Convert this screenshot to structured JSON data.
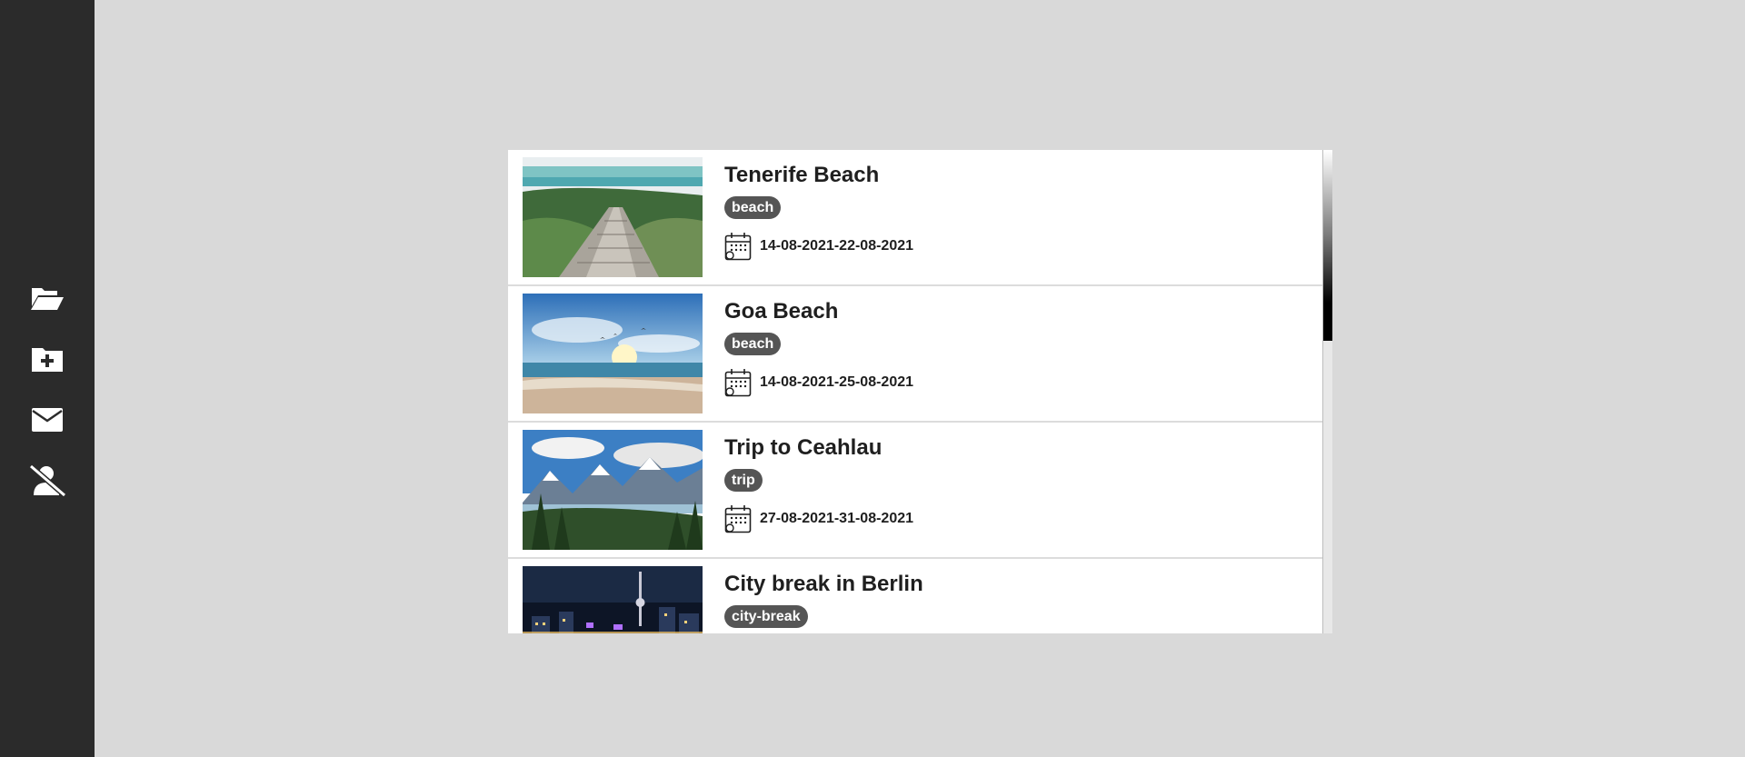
{
  "sidebar": {
    "items": [
      {
        "icon": "folder-open-icon"
      },
      {
        "icon": "folder-plus-icon"
      },
      {
        "icon": "envelope-icon"
      },
      {
        "icon": "user-slash-icon"
      }
    ]
  },
  "trips": [
    {
      "title": "Tenerife Beach",
      "tag": "beach",
      "start": "14-08-2021",
      "end": "22-08-2021",
      "image": "boardwalk-beach"
    },
    {
      "title": "Goa Beach",
      "tag": "beach",
      "start": "14-08-2021",
      "end": "25-08-2021",
      "image": "sunset-sea"
    },
    {
      "title": "Trip to Ceahlau",
      "tag": "trip",
      "start": "27-08-2021",
      "end": "31-08-2021",
      "image": "mountain-lake"
    },
    {
      "title": "City break in Berlin",
      "tag": "city-break",
      "start": "",
      "end": "",
      "image": "berlin-night-skyline"
    }
  ],
  "date_separator": "-",
  "colors": {
    "sidebar": "#2b2b2b",
    "background": "#d9d9d9",
    "tag": "#555555"
  }
}
